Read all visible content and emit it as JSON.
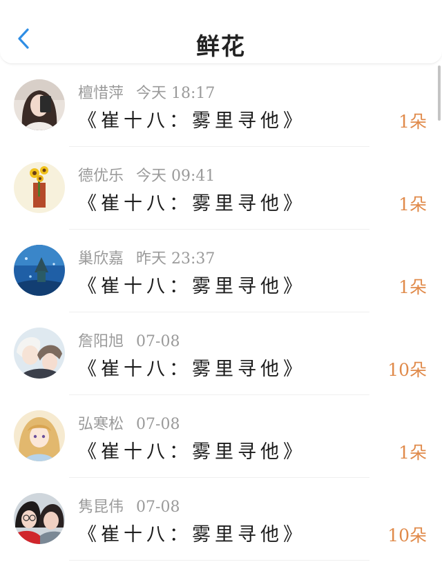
{
  "header": {
    "title": "鲜花",
    "back_icon": "chevron-left-icon",
    "accent_color": "#2f8ee5"
  },
  "amount_color": "#e08a4a",
  "items": [
    {
      "name": "檀惜萍",
      "time": "今天 18:17",
      "book": "《崔十八：雾里寻他》",
      "amount": "1朵",
      "avatar": "girl-selfie-avatar"
    },
    {
      "name": "德优乐",
      "time": "今天 09:41",
      "book": "《崔十八：雾里寻他》",
      "amount": "1朵",
      "avatar": "sunflower-avatar"
    },
    {
      "name": "巢欣嘉",
      "time": "昨天 23:37",
      "book": "《崔十八：雾里寻他》",
      "amount": "1朵",
      "avatar": "blue-night-castle-avatar"
    },
    {
      "name": "詹阳旭",
      "time": "07-08",
      "book": "《崔十八：雾里寻他》",
      "amount": "10朵",
      "avatar": "anime-boys-avatar"
    },
    {
      "name": "弘寒松",
      "time": "07-08",
      "book": "《崔十八：雾里寻他》",
      "amount": "1朵",
      "avatar": "anime-girl-avatar"
    },
    {
      "name": "隽昆伟",
      "time": "07-08",
      "book": "《崔十八：雾里寻他》",
      "amount": "10朵",
      "avatar": "two-girls-photo-avatar"
    }
  ]
}
